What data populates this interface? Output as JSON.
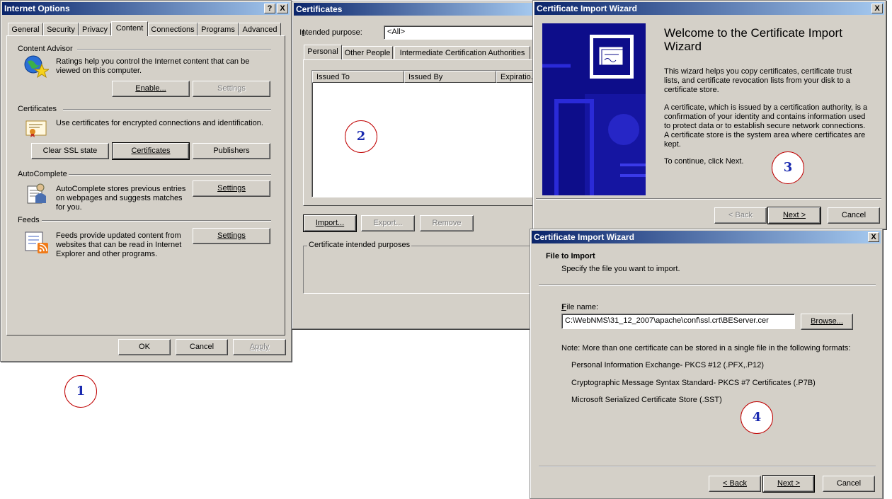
{
  "internet_options": {
    "title": "Internet Options",
    "help_btn": "?",
    "close_btn": "X",
    "tabs": [
      "General",
      "Security",
      "Privacy",
      "Content",
      "Connections",
      "Programs",
      "Advanced"
    ],
    "content_advisor": {
      "heading": "Content Advisor",
      "text": "Ratings help you control the Internet content that can be viewed on this computer.",
      "enable_btn": "Enable...",
      "settings_btn": "Settings"
    },
    "certificates": {
      "heading": "Certificates",
      "text": "Use certificates for encrypted connections and identification.",
      "clear_ssl_btn": "Clear SSL state",
      "certificates_btn": "Certificates",
      "publishers_btn": "Publishers"
    },
    "autocomplete": {
      "heading": "AutoComplete",
      "text": "AutoComplete stores previous entries on webpages and suggests matches for you.",
      "settings_btn": "Settings"
    },
    "feeds": {
      "heading": "Feeds",
      "text": "Feeds provide updated content from websites that can be read in Internet Explorer and other programs.",
      "settings_btn": "Settings"
    },
    "ok_btn": "OK",
    "cancel_btn": "Cancel",
    "apply_btn": "Apply"
  },
  "certificates_dialog": {
    "title": "Certificates",
    "intended_purpose_label": "Intended purpose:",
    "intended_purpose_value": "<All>",
    "tabs": [
      "Personal",
      "Other People",
      "Intermediate Certification Authorities"
    ],
    "columns": [
      "Issued To",
      "Issued By",
      "Expiratio..."
    ],
    "import_btn": "Import...",
    "export_btn": "Export...",
    "remove_btn": "Remove",
    "purposes_group": "Certificate intended purposes"
  },
  "import_wizard_welcome": {
    "title": "Certificate Import Wizard",
    "close_btn": "X",
    "heading": "Welcome to the Certificate Import Wizard",
    "para1": "This wizard helps you copy certificates, certificate trust lists, and certificate revocation lists from your disk to a certificate store.",
    "para2": "A certificate, which is issued by a certification authority, is a confirmation of your identity and contains information used to protect data or to establish secure network connections. A certificate store is the system area where certificates are kept.",
    "para3": "To continue, click Next.",
    "back_btn": "< Back",
    "next_btn": "Next >",
    "cancel_btn": "Cancel"
  },
  "import_wizard_file": {
    "title": "Certificate Import Wizard",
    "close_btn": "X",
    "heading": "File to Import",
    "subheading": "Specify the file you want to import.",
    "file_name_label": "File name:",
    "file_name_value": "C:\\WebNMS\\31_12_2007\\apache\\conf\\ssl.crt\\BEServer.cer",
    "browse_btn": "Browse...",
    "note": "Note:  More than one certificate can be stored in a single file in the following formats:",
    "formats": [
      "Personal Information Exchange- PKCS #12 (.PFX,.P12)",
      "Cryptographic Message Syntax Standard- PKCS #7 Certificates (.P7B)",
      "Microsoft Serialized Certificate Store (.SST)"
    ],
    "back_btn": "< Back",
    "next_btn": "Next >",
    "cancel_btn": "Cancel"
  },
  "step_markers": [
    "1",
    "2",
    "3",
    "4"
  ],
  "colors": {
    "dialog_face": "#d4d0c8",
    "titlebar_start": "#0a246a",
    "titlebar_end": "#a6caf0",
    "marker_ring": "#c00000",
    "marker_text": "#1a2ab0",
    "wizard_banner": "#0d0d8a"
  }
}
